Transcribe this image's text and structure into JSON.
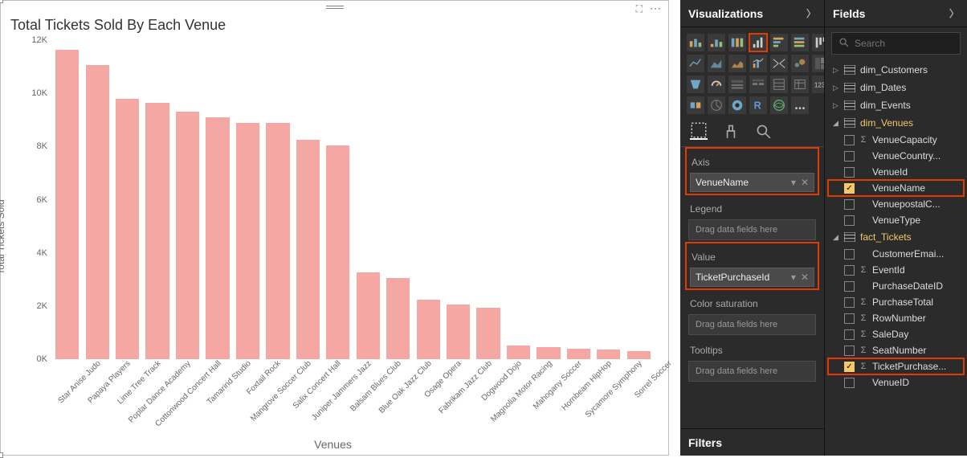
{
  "chart_data": {
    "type": "bar",
    "title": "Total Tickets Sold By Each Venue",
    "xlabel": "Venues",
    "ylabel": "Total Tickets Sold",
    "ylim": [
      0,
      12000
    ],
    "yticks": [
      0,
      2000,
      4000,
      6000,
      8000,
      10000,
      12000
    ],
    "yticklabels": [
      "0K",
      "2K",
      "4K",
      "6K",
      "8K",
      "10K",
      "12K"
    ],
    "categories": [
      "Star Anise Judo",
      "Papaya Players",
      "Lime Tree Track",
      "Poplar Dance Academy",
      "Cottonwood Concert Hall",
      "Tamarind Studio",
      "Foxtail Rock",
      "Mangrove Soccer Club",
      "Salix Concert Hall",
      "Juniper Jammers Jazz",
      "Balsam Blues Club",
      "Blue Oak Jazz Club",
      "Osage Opera",
      "Fabrikam Jazz Club",
      "Dogwood Dojo",
      "Magnolia Motor Racing",
      "Mahogany Soccer",
      "Hornbeam HipHop",
      "Sycamore Symphony",
      "Sorrel Soccer"
    ],
    "values": [
      11650,
      11050,
      9800,
      9650,
      9300,
      9100,
      8900,
      8900,
      8250,
      8050,
      3250,
      3050,
      2250,
      2050,
      1950,
      500,
      450,
      400,
      350,
      300
    ]
  },
  "viz_panel": {
    "title": "Visualizations",
    "axis": {
      "label": "Axis",
      "field": "VenueName"
    },
    "legend": {
      "label": "Legend",
      "placeholder": "Drag data fields here"
    },
    "value": {
      "label": "Value",
      "field": "TicketPurchaseId"
    },
    "color": {
      "label": "Color saturation",
      "placeholder": "Drag data fields here"
    },
    "tooltips": {
      "label": "Tooltips",
      "placeholder": "Drag data fields here"
    },
    "filters": {
      "label": "Filters"
    }
  },
  "fields_panel": {
    "title": "Fields",
    "search_placeholder": "Search",
    "tables": [
      {
        "name": "dim_Customers",
        "expanded": false,
        "fields": []
      },
      {
        "name": "dim_Dates",
        "expanded": false,
        "fields": []
      },
      {
        "name": "dim_Events",
        "expanded": false,
        "fields": []
      },
      {
        "name": "dim_Venues",
        "expanded": true,
        "fields": [
          {
            "name": "VenueCapacity",
            "checked": false,
            "sigma": true
          },
          {
            "name": "VenueCountry...",
            "checked": false,
            "sigma": false
          },
          {
            "name": "VenueId",
            "checked": false,
            "sigma": false
          },
          {
            "name": "VenueName",
            "checked": true,
            "sigma": false,
            "highlight": true
          },
          {
            "name": "VenuepostalC...",
            "checked": false,
            "sigma": false
          },
          {
            "name": "VenueType",
            "checked": false,
            "sigma": false
          }
        ]
      },
      {
        "name": "fact_Tickets",
        "expanded": true,
        "fields": [
          {
            "name": "CustomerEmai...",
            "checked": false,
            "sigma": false
          },
          {
            "name": "EventId",
            "checked": false,
            "sigma": true
          },
          {
            "name": "PurchaseDateID",
            "checked": false,
            "sigma": false
          },
          {
            "name": "PurchaseTotal",
            "checked": false,
            "sigma": true
          },
          {
            "name": "RowNumber",
            "checked": false,
            "sigma": true
          },
          {
            "name": "SaleDay",
            "checked": false,
            "sigma": true
          },
          {
            "name": "SeatNumber",
            "checked": false,
            "sigma": true
          },
          {
            "name": "TicketPurchase...",
            "checked": true,
            "sigma": true,
            "highlight": true
          },
          {
            "name": "VenueID",
            "checked": false,
            "sigma": false
          }
        ]
      }
    ]
  }
}
